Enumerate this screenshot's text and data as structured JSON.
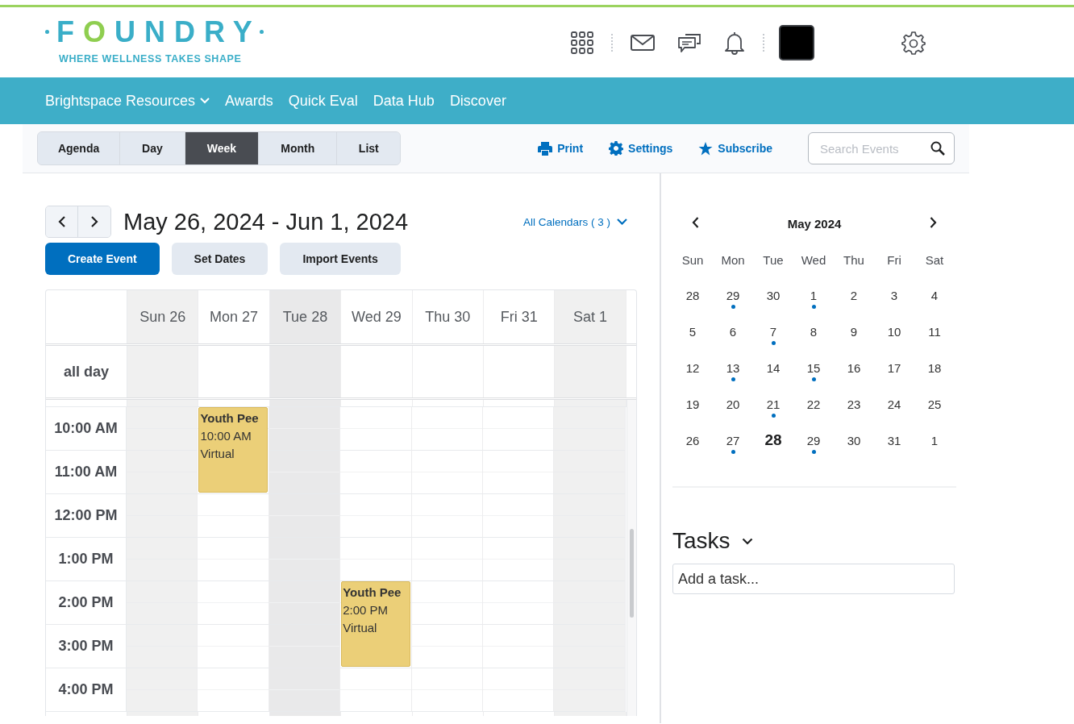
{
  "logo": {
    "wordmark": [
      {
        "text": "F",
        "accent": false
      },
      {
        "text": "O",
        "accent": true
      },
      {
        "text": "UNDRY",
        "accent": false
      }
    ],
    "tagline": "WHERE WELLNESS TAKES SHAPE"
  },
  "nav": [
    {
      "label": "Brightspace Resources",
      "dropdown": true
    },
    {
      "label": "Awards",
      "dropdown": false
    },
    {
      "label": "Quick Eval",
      "dropdown": false
    },
    {
      "label": "Data Hub",
      "dropdown": false
    },
    {
      "label": "Discover",
      "dropdown": false
    }
  ],
  "view_tabs": [
    {
      "label": "Agenda",
      "selected": false
    },
    {
      "label": "Day",
      "selected": false
    },
    {
      "label": "Week",
      "selected": true
    },
    {
      "label": "Month",
      "selected": false
    },
    {
      "label": "List",
      "selected": false
    }
  ],
  "actions": [
    {
      "kind": "print",
      "label": "Print"
    },
    {
      "kind": "settings",
      "label": "Settings"
    },
    {
      "kind": "star",
      "label": "Subscribe"
    }
  ],
  "search": {
    "placeholder": "Search Events"
  },
  "date_range": "May 26, 2024 - Jun 1, 2024",
  "calendars_filter": "All Calendars ( 3 )",
  "buttons": [
    {
      "label": "Create Event",
      "primary": true
    },
    {
      "label": "Set Dates",
      "primary": false
    },
    {
      "label": "Import Events",
      "primary": false
    }
  ],
  "week": {
    "days": [
      {
        "label": "Sun 26",
        "today": false,
        "weekend": true
      },
      {
        "label": "Mon 27",
        "today": false,
        "weekend": false
      },
      {
        "label": "Tue 28",
        "today": true,
        "weekend": false
      },
      {
        "label": "Wed 29",
        "today": false,
        "weekend": false
      },
      {
        "label": "Thu 30",
        "today": false,
        "weekend": false
      },
      {
        "label": "Fri 31",
        "today": false,
        "weekend": false
      },
      {
        "label": "Sat 1",
        "today": false,
        "weekend": true
      }
    ],
    "all_day_label": "all day",
    "rows": [
      {
        "time": "10:00 AM",
        "cells": [
          {},
          {
            "event": {
              "title": "Youth Pee",
              "time": "10:00 AM",
              "location": "Virtual"
            }
          },
          {},
          {},
          {},
          {},
          {}
        ]
      },
      {
        "time": "11:00 AM",
        "cells": [
          {},
          {},
          {},
          {},
          {},
          {},
          {}
        ]
      },
      {
        "time": "12:00 PM",
        "cells": [
          {},
          {},
          {},
          {},
          {},
          {},
          {}
        ]
      },
      {
        "time": "1:00 PM",
        "cells": [
          {},
          {},
          {},
          {},
          {},
          {},
          {}
        ]
      },
      {
        "time": "2:00 PM",
        "cells": [
          {},
          {},
          {},
          {
            "event": {
              "title": "Youth Pee",
              "time": "2:00 PM",
              "location": "Virtual"
            }
          },
          {},
          {},
          {}
        ]
      },
      {
        "time": "3:00 PM",
        "cells": [
          {},
          {},
          {},
          {},
          {},
          {},
          {}
        ]
      },
      {
        "time": "4:00 PM",
        "cells": [
          {},
          {},
          {},
          {},
          {},
          {},
          {}
        ]
      }
    ]
  },
  "mini_calendar": {
    "title": "May 2024",
    "weekdays": [
      "Sun",
      "Mon",
      "Tue",
      "Wed",
      "Thu",
      "Fri",
      "Sat"
    ],
    "weeks": [
      [
        {
          "day": "28",
          "has_events": false,
          "today": false
        },
        {
          "day": "29",
          "has_events": true,
          "today": false
        },
        {
          "day": "30",
          "has_events": false,
          "today": false
        },
        {
          "day": "1",
          "has_events": true,
          "today": false
        },
        {
          "day": "2",
          "has_events": false,
          "today": false
        },
        {
          "day": "3",
          "has_events": false,
          "today": false
        },
        {
          "day": "4",
          "has_events": false,
          "today": false
        }
      ],
      [
        {
          "day": "5",
          "has_events": false,
          "today": false
        },
        {
          "day": "6",
          "has_events": false,
          "today": false
        },
        {
          "day": "7",
          "has_events": true,
          "today": false
        },
        {
          "day": "8",
          "has_events": false,
          "today": false
        },
        {
          "day": "9",
          "has_events": false,
          "today": false
        },
        {
          "day": "10",
          "has_events": false,
          "today": false
        },
        {
          "day": "11",
          "has_events": false,
          "today": false
        }
      ],
      [
        {
          "day": "12",
          "has_events": false,
          "today": false
        },
        {
          "day": "13",
          "has_events": true,
          "today": false
        },
        {
          "day": "14",
          "has_events": false,
          "today": false
        },
        {
          "day": "15",
          "has_events": true,
          "today": false
        },
        {
          "day": "16",
          "has_events": false,
          "today": false
        },
        {
          "day": "17",
          "has_events": false,
          "today": false
        },
        {
          "day": "18",
          "has_events": false,
          "today": false
        }
      ],
      [
        {
          "day": "19",
          "has_events": false,
          "today": false
        },
        {
          "day": "20",
          "has_events": false,
          "today": false
        },
        {
          "day": "21",
          "has_events": true,
          "today": false
        },
        {
          "day": "22",
          "has_events": false,
          "today": false
        },
        {
          "day": "23",
          "has_events": false,
          "today": false
        },
        {
          "day": "24",
          "has_events": false,
          "today": false
        },
        {
          "day": "25",
          "has_events": false,
          "today": false
        }
      ],
      [
        {
          "day": "26",
          "has_events": false,
          "today": false
        },
        {
          "day": "27",
          "has_events": true,
          "today": false
        },
        {
          "day": "28",
          "has_events": false,
          "today": true
        },
        {
          "day": "29",
          "has_events": true,
          "today": false
        },
        {
          "day": "30",
          "has_events": false,
          "today": false
        },
        {
          "day": "31",
          "has_events": false,
          "today": false
        },
        {
          "day": "1",
          "has_events": false,
          "today": false
        }
      ]
    ]
  },
  "tasks": {
    "title": "Tasks",
    "placeholder": "Add a task..."
  }
}
